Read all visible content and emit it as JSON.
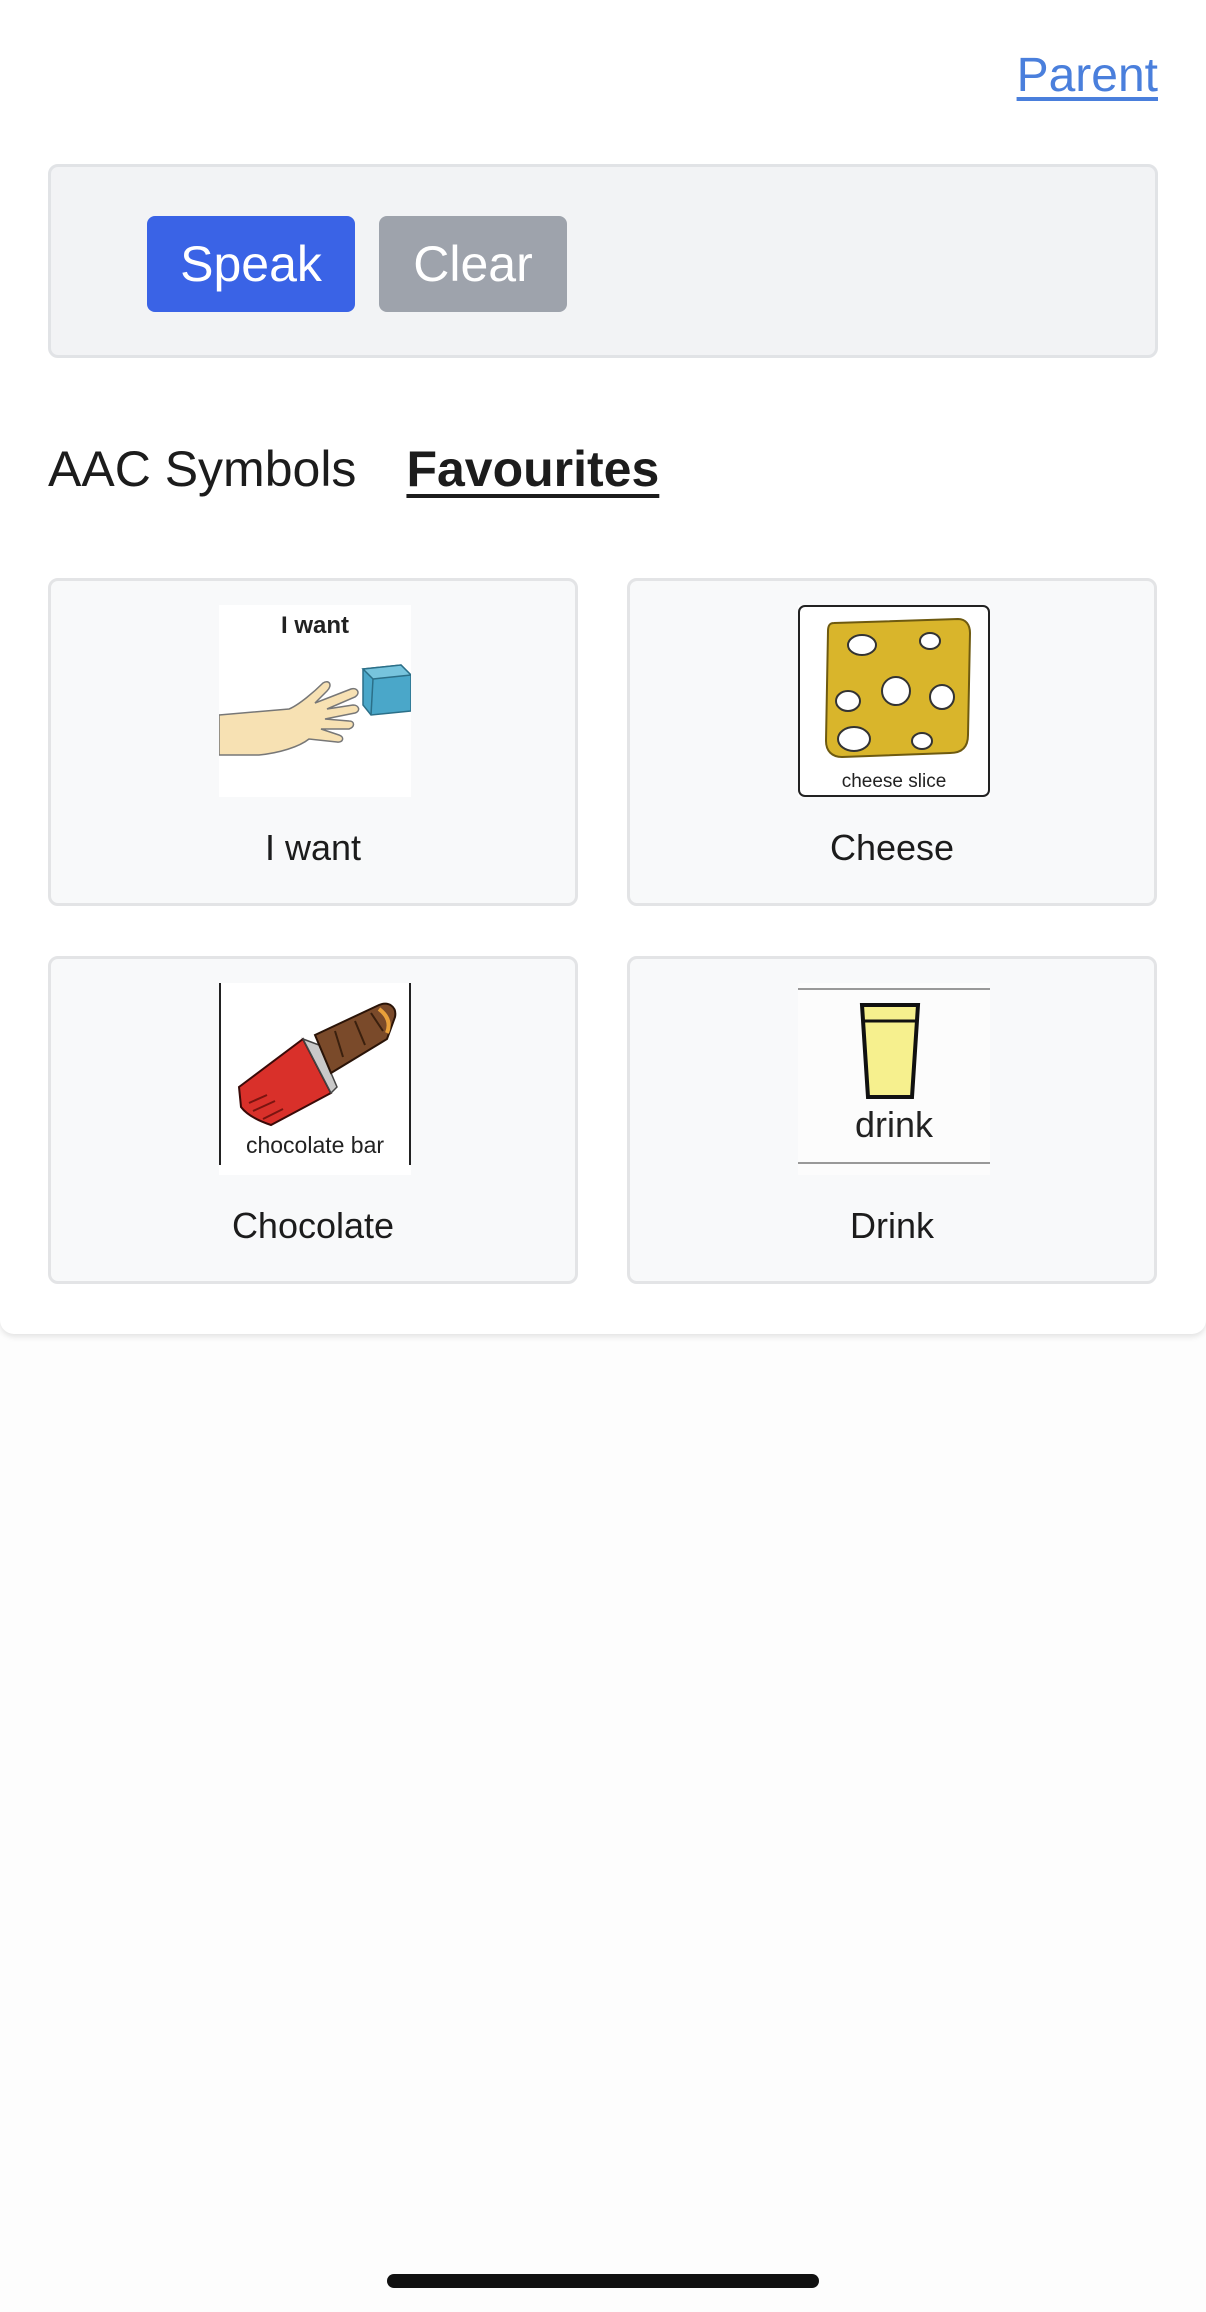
{
  "header": {
    "parent_link": "Parent"
  },
  "speech_bar": {
    "speak_label": "Speak",
    "clear_label": "Clear"
  },
  "tabs": [
    {
      "label": "AAC Symbols",
      "active": false
    },
    {
      "label": "Favourites",
      "active": true
    }
  ],
  "tiles": [
    {
      "label": "I want",
      "symbol_caption": "I want",
      "icon": "reaching-hand-icon"
    },
    {
      "label": "Cheese",
      "symbol_caption": "cheese slice",
      "icon": "cheese-icon"
    },
    {
      "label": "Chocolate",
      "symbol_caption": "chocolate bar",
      "icon": "chocolate-bar-icon"
    },
    {
      "label": "Drink",
      "symbol_caption": "drink",
      "icon": "glass-icon"
    }
  ],
  "colors": {
    "accent": "#3a63e6",
    "secondary_button": "#9ea3ac",
    "link": "#4a7fdc"
  }
}
